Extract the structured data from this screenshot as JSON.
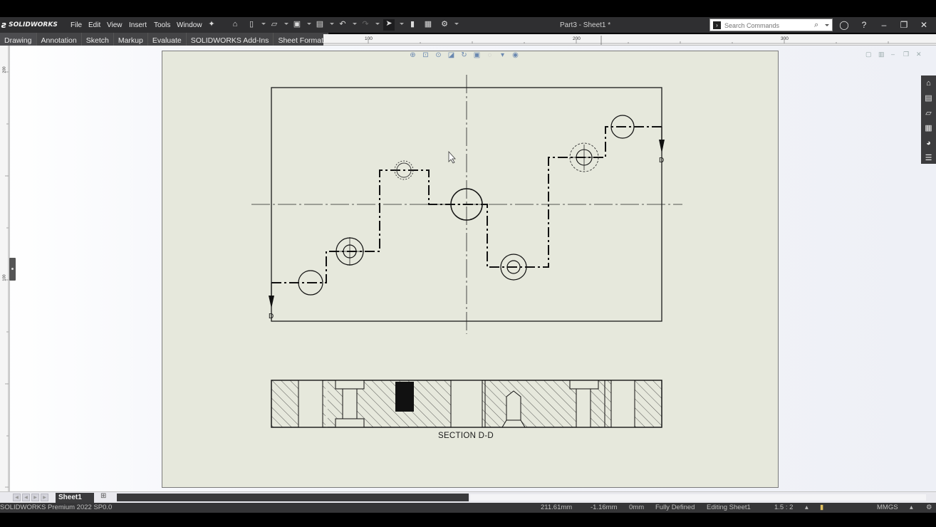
{
  "app": {
    "brand": "SOLIDWORKS",
    "document_title": "Part3 - Sheet1 *"
  },
  "menu": [
    "File",
    "Edit",
    "View",
    "Insert",
    "Tools",
    "Window"
  ],
  "search": {
    "placeholder": "Search Commands"
  },
  "tabs": [
    "Drawing",
    "Annotation",
    "Sketch",
    "Markup",
    "Evaluate",
    "SOLIDWORKS Add-Ins",
    "Sheet Format"
  ],
  "ruler_top_labels": [
    "100",
    "200",
    "300"
  ],
  "ruler_left_labels": [
    "200",
    "100"
  ],
  "drawing": {
    "section_letter_left": "D",
    "section_letter_right": "D",
    "section_label": "SECTION D-D"
  },
  "sheet_tabs": {
    "active": "Sheet1"
  },
  "status": {
    "product": "SOLIDWORKS Premium 2022 SP0.0",
    "x": "211.61mm",
    "y": "-1.16mm",
    "z": "0mm",
    "state": "Fully Defined",
    "editing": "Editing Sheet1",
    "scale": "1.5 : 2",
    "units": "MMGS"
  },
  "icons": [
    "solidworks-logo-icon",
    "pin-icon",
    "home-icon",
    "new-document-icon",
    "open-icon",
    "save-icon",
    "print-icon",
    "undo-icon",
    "select-icon",
    "rebuild-icon",
    "file-properties-icon",
    "options-icon",
    "search-icon",
    "user-icon",
    "help-icon",
    "minimize-icon",
    "restore-icon",
    "close-icon"
  ]
}
